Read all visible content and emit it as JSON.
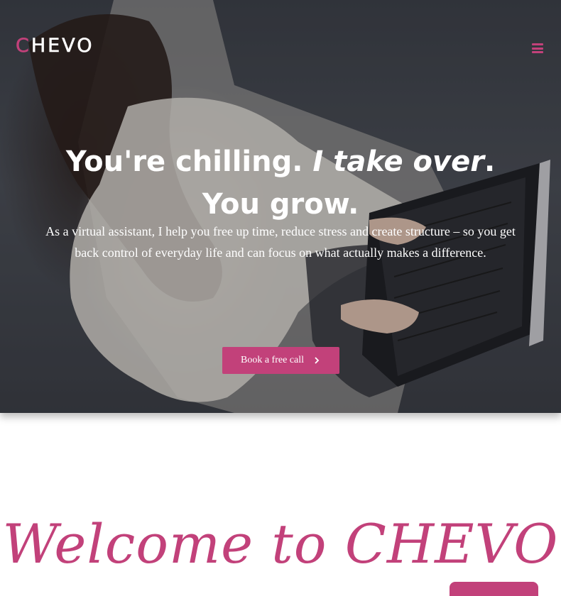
{
  "header": {
    "logo_first": "C",
    "logo_rest": "HEVO",
    "menu_icon": "hamburger-icon"
  },
  "hero": {
    "headline_part1": "You're chilling.",
    "headline_part2": "I take over",
    "headline_part3": ".",
    "headline_line2": "You grow.",
    "subtext": "As a virtual assistant, I help you free up time, reduce stress and create structure – so you get back control of everyday life and can focus on what actually makes a difference.",
    "cta_label": "Book a free call",
    "cta_icon": "chevron-right-icon"
  },
  "welcome": {
    "title": "Welcome to CHEVO"
  },
  "colors": {
    "accent": "#c2417a",
    "text_light": "#ffffff",
    "background": "#ffffff"
  }
}
